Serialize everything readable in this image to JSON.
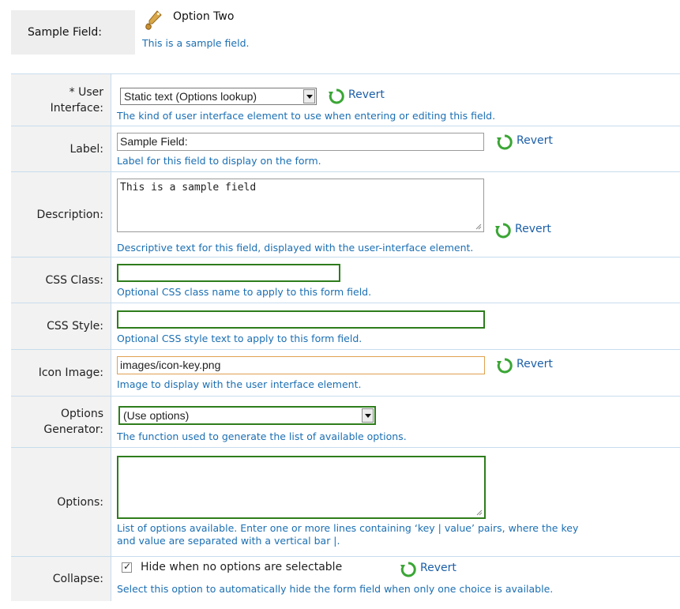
{
  "preview": {
    "label": "Sample Field:",
    "value": "Option Two",
    "description": "This is a sample field."
  },
  "form": {
    "revert_label": "Revert",
    "rows": {
      "ui": {
        "required_marker": "*",
        "label_line1": "User",
        "label_line2": "Interface:",
        "select_value": "Static text (Options lookup)",
        "help": "The kind of user interface element to use when entering or editing this field."
      },
      "label": {
        "label": "Label:",
        "value": "Sample Field:",
        "help": "Label for this field to display on the form."
      },
      "description": {
        "label": "Description:",
        "value": "This is a sample field",
        "help": "Descriptive text for this field, displayed with the user-interface element."
      },
      "css_class": {
        "label": "CSS Class:",
        "value": "",
        "help": "Optional CSS class name to apply to this form field."
      },
      "css_style": {
        "label": "CSS Style:",
        "value": "",
        "help": "Optional CSS style text to apply to this form field."
      },
      "icon_image": {
        "label": "Icon Image:",
        "value": "images/icon-key.png",
        "help": "Image to display with the user interface element."
      },
      "options_generator": {
        "label_line1": "Options",
        "label_line2": "Generator:",
        "select_value": "(Use options)",
        "help": "The function used to generate the list of available options."
      },
      "options": {
        "label": "Options:",
        "value": "",
        "help_line1": "List of options available. Enter one or more lines containing ‘key | value’ pairs, where the key",
        "help_line2": "and value are separated with a vertical bar |."
      },
      "collapse": {
        "label": "Collapse:",
        "checkbox_label": "Hide when no options are selectable",
        "checked": true,
        "help": "Select this option to automatically hide the form field when only one choice is available."
      }
    }
  },
  "colors": {
    "help_text": "#1b6fb3",
    "active_border": "#2e7d1c",
    "focus_border": "#e0a050",
    "revert_icon": "#3aa635"
  },
  "icons": [
    "key-icon",
    "revert-icon",
    "dropdown-arrow-icon",
    "resize-grip-icon",
    "checkbox-checked-icon"
  ]
}
